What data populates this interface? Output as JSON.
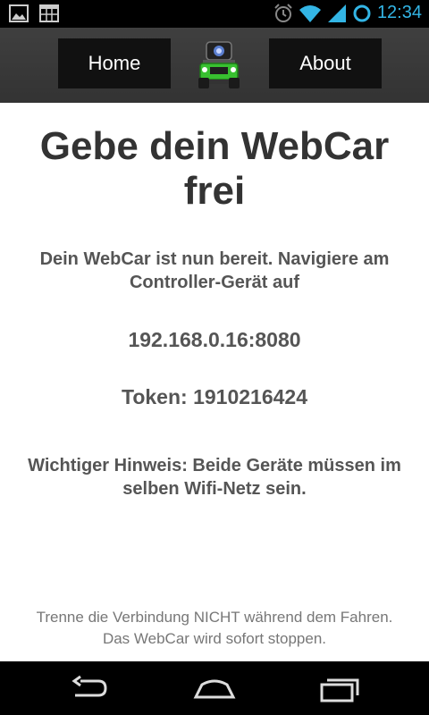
{
  "status_bar": {
    "time": "12:34",
    "accent": "#33b5e5",
    "icons": [
      "image-notification-icon",
      "calendar-notification-icon",
      "alarm-icon",
      "wifi-icon",
      "signal-icon",
      "sync-icon"
    ]
  },
  "action_bar": {
    "home_label": "Home",
    "about_label": "About",
    "logo_icon": "jeep-robot-logo"
  },
  "main": {
    "title": "Gebe dein WebCar frei",
    "ready_text": "Dein WebCar ist nun bereit. Navigiere am Controller-Gerät auf",
    "address": "192.168.0.16:8080",
    "token": "Token: 1910216424",
    "hint": "Wichtiger Hinweis: Beide Geräte müssen im selben Wifi-Netz sein.",
    "footer_line1": "Trenne die Verbindung NICHT während dem Fahren.",
    "footer_line2": "Das WebCar wird sofort stoppen."
  },
  "nav_bar": {
    "icons": [
      "back-icon",
      "home-icon",
      "recent-apps-icon"
    ]
  }
}
